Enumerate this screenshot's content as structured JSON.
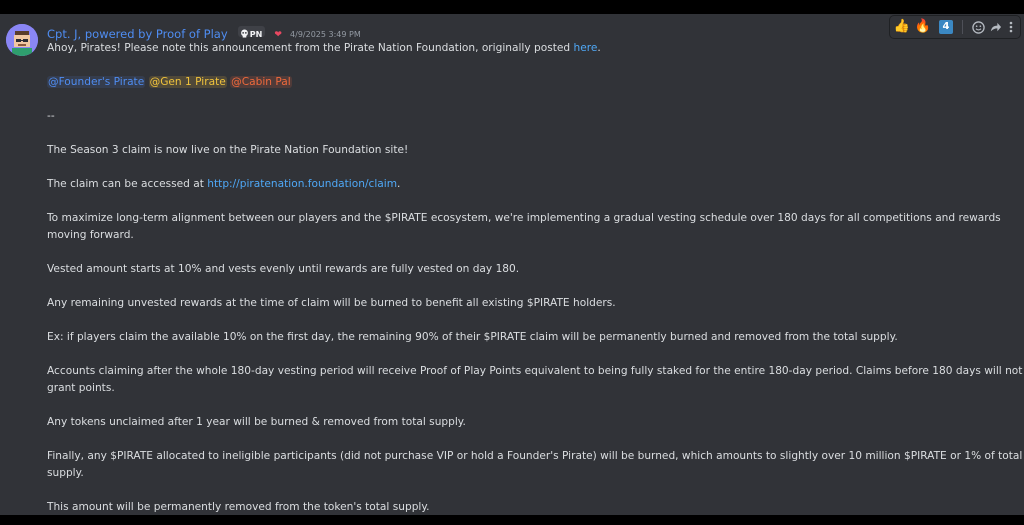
{
  "message": {
    "author": "Cpt. J, powered by Proof of Play",
    "server_badge": "PN",
    "timestamp": "4/9/2025 3:49 PM",
    "greeting_prefix": "Ahoy, Pirates! Please note this announcement from the Pirate Nation Foundation, originally posted ",
    "greeting_link": "here",
    "greeting_suffix": ".",
    "mentions": [
      "@Founder's Pirate",
      "@Gen 1 Pirate",
      "@Cabin Pal"
    ],
    "divider": "--",
    "p1": "The Season 3 claim is now live on the Pirate Nation Foundation site!",
    "p2_prefix": "The claim can be accessed at ",
    "p2_link": "http://piratenation.foundation/claim",
    "p2_suffix": ".",
    "p3": "To maximize long-term alignment between our players and the $PIRATE ecosystem, we're implementing a gradual vesting schedule over 180 days for all competitions and rewards moving forward.",
    "p4": "Vested amount starts at 10% and vests evenly until rewards are fully vested on day 180.",
    "p5": "Any remaining unvested rewards at the time of claim will be burned to benefit all existing $PIRATE holders.",
    "p6": "Ex: if players claim the available 10% on the first day, the remaining 90% of their $PIRATE claim will be permanently burned and removed from the total supply.",
    "p7": "Accounts claiming after the whole 180-day vesting period will receive Proof of Play Points equivalent to being fully staked for the entire 180-day period. Claims before 180 days will not grant points.",
    "p8": "Any tokens unclaimed after 1 year will be burned & removed from total supply.",
    "p9": "Finally, any $PIRATE allocated to ineligible participants (did not purchase VIP or hold a Founder's Pirate) will be burned, which amounts to slightly over 10 million $PIRATE or 1% of total supply.",
    "p10": "This amount will be permanently removed from the token's total supply."
  },
  "hover_actions": {
    "reaction_1": "👍",
    "reaction_2": "🔥",
    "reaction_3": "4",
    "icons": [
      "thumbs-up-icon",
      "fire-icon",
      "keycap-4-icon",
      "add-reaction-icon",
      "reply-icon",
      "more-icon"
    ]
  },
  "colors": {
    "background": "#313338",
    "text": "#dbdee1",
    "author": "#4f8df2",
    "link": "#4fa8f6",
    "mention_founder": "#4f8df2",
    "mention_gen1": "#f0c33c",
    "mention_cabin": "#f06a3c",
    "timestamp": "#949ba4"
  }
}
